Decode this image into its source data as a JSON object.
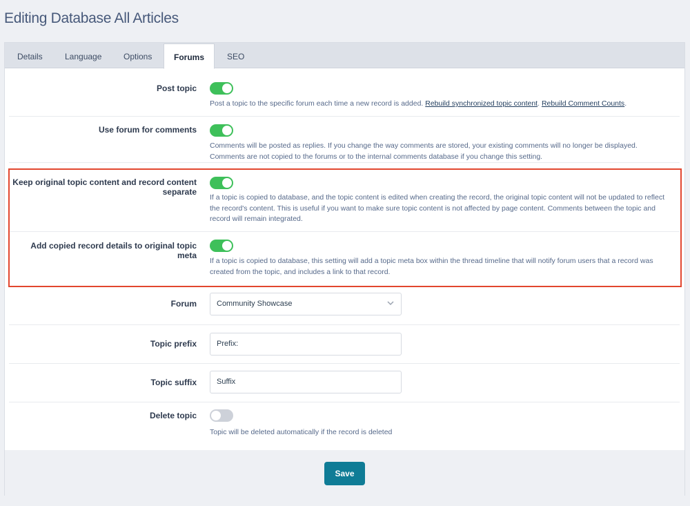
{
  "page": {
    "title": "Editing Database All Articles"
  },
  "tabs": [
    {
      "label": "Details",
      "active": false
    },
    {
      "label": "Language",
      "active": false
    },
    {
      "label": "Options",
      "active": false
    },
    {
      "label": "Forums",
      "active": true
    },
    {
      "label": "SEO",
      "active": false
    }
  ],
  "settings": {
    "post_topic": {
      "label": "Post topic",
      "enabled": true,
      "help": "Post a topic to the specific forum each time a new record is added.",
      "link1": "Rebuild synchronized topic content",
      "link2": "Rebuild Comment Counts"
    },
    "forum_comments": {
      "label": "Use forum for comments",
      "enabled": true,
      "help": "Comments will be posted as replies. If you change the way comments are stored, your existing comments will no longer be displayed. Comments are not copied to the forums or to the internal comments database if you change this setting."
    },
    "keep_separate": {
      "label": "Keep original topic content and record content separate",
      "enabled": true,
      "help": "If a topic is copied to database, and the topic content is edited when creating the record, the original topic content will not be updated to reflect the record's content. This is useful if you want to make sure topic content is not affected by page content. Comments between the topic and record will remain integrated."
    },
    "copied_details": {
      "label": "Add copied record details to original topic meta",
      "enabled": true,
      "help": "If a topic is copied to database, this setting will add a topic meta box within the thread timeline that will notify forum users that a record was created from the topic, and includes a link to that record."
    },
    "forum": {
      "label": "Forum",
      "value": "Community Showcase"
    },
    "prefix": {
      "label": "Topic prefix",
      "value": "Prefix:"
    },
    "suffix": {
      "label": "Topic suffix",
      "value": "Suffix"
    },
    "delete_topic": {
      "label": "Delete topic",
      "enabled": false,
      "help": "Topic will be deleted automatically if the record is deleted"
    }
  },
  "actions": {
    "save_label": "Save"
  },
  "colors": {
    "toggle_on": "#3ec05a",
    "toggle_off": "#cdd1d9",
    "save_button": "#0f7c96",
    "highlight_border": "#e2462e"
  }
}
